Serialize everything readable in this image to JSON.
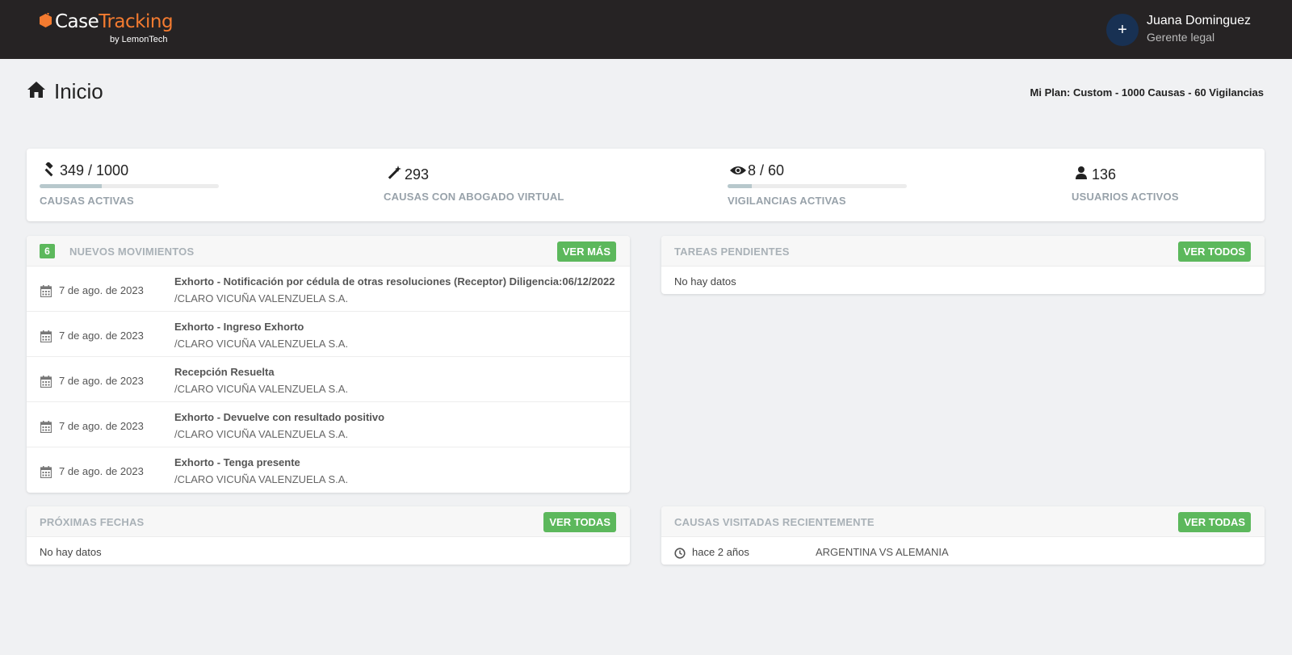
{
  "header": {
    "logo_case": "Case",
    "logo_tracking": "Tracking",
    "logo_by": "by LemonTech",
    "user_initial": "+",
    "user_name": "Juana Dominguez",
    "user_role": "Gerente legal"
  },
  "page": {
    "title": "Inicio",
    "plan": "Mi Plan: Custom - 1000 Causas - 60 Vigilancias"
  },
  "stats": [
    {
      "icon": "gavel-icon",
      "value": "349 / 1000",
      "label": "CAUSAS ACTIVAS",
      "progress": 0.349
    },
    {
      "icon": "magic-wand-icon",
      "value": "293",
      "label": "CAUSAS CON ABOGADO VIRTUAL"
    },
    {
      "icon": "eye-icon",
      "value": "8 / 60",
      "label": "VIGILANCIAS ACTIVAS",
      "progress": 0.133
    },
    {
      "icon": "user-icon",
      "value": "136",
      "label": "USUARIOS ACTIVOS"
    }
  ],
  "movimientos": {
    "count": "6",
    "title": "NUEVOS MOVIMIENTOS",
    "button": "VER MÁS",
    "rows": [
      {
        "date": "7 de ago. de 2023",
        "title": "Exhorto - Notificación por cédula de otras resoluciones (Receptor) Diligencia:06/12/2022",
        "sub": "/CLARO VICUÑA VALENZUELA S.A."
      },
      {
        "date": "7 de ago. de 2023",
        "title": "Exhorto - Ingreso Exhorto",
        "sub": "/CLARO VICUÑA VALENZUELA S.A."
      },
      {
        "date": "7 de ago. de 2023",
        "title": "Recepción Resuelta",
        "sub": "/CLARO VICUÑA VALENZUELA S.A."
      },
      {
        "date": "7 de ago. de 2023",
        "title": "Exhorto - Devuelve con resultado positivo",
        "sub": "/CLARO VICUÑA VALENZUELA S.A."
      },
      {
        "date": "7 de ago. de 2023",
        "title": "Exhorto - Tenga presente",
        "sub": "/CLARO VICUÑA VALENZUELA S.A."
      }
    ]
  },
  "tareas": {
    "title": "TAREAS PENDIENTES",
    "button": "VER TODOS",
    "empty": "No hay datos"
  },
  "fechas": {
    "title": "PRÓXIMAS FECHAS",
    "button": "VER TODAS",
    "empty": "No hay datos"
  },
  "recientes": {
    "title": "CAUSAS VISITADAS RECIENTEMENTE",
    "button": "VER TODAS",
    "rows": [
      {
        "time": "hace 2 años",
        "name": "ARGENTINA VS ALEMANIA"
      }
    ]
  },
  "colors": {
    "topbar": "#262324",
    "brand_orange": "#f47b30",
    "button_green": "#5cb85c",
    "avatar": "#183153"
  }
}
